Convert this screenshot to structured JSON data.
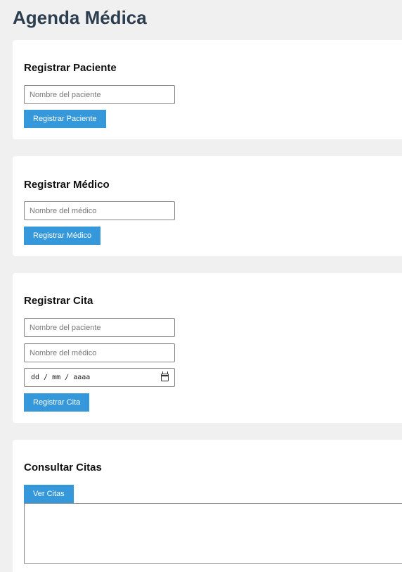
{
  "app": {
    "title": "Agenda Médica"
  },
  "registrar_paciente": {
    "heading": "Registrar Paciente",
    "nombre_placeholder": "Nombre del paciente",
    "nombre_value": "",
    "button_label": "Registrar Paciente"
  },
  "registrar_medico": {
    "heading": "Registrar Médico",
    "nombre_placeholder": "Nombre del médico",
    "nombre_value": "",
    "button_label": "Registrar Médico"
  },
  "registrar_cita": {
    "heading": "Registrar Cita",
    "paciente_placeholder": "Nombre del paciente",
    "medico_placeholder": "Nombre del médico",
    "fecha_display": "dd / mm / aaaa",
    "button_label": "Registrar Cita",
    "icons": {
      "date_picker": "calendar-icon"
    }
  },
  "consultar_citas": {
    "heading": "Consultar Citas",
    "button_label": "Ver Citas",
    "results_text": ""
  },
  "colors": {
    "title": "#2c3e50",
    "button": "#3498db",
    "background": "#f0f0f0",
    "card": "#ffffff"
  }
}
